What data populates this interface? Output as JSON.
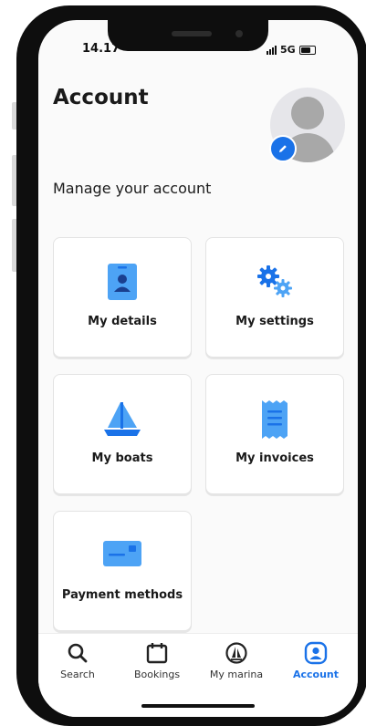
{
  "status_bar": {
    "time": "14.17",
    "network": "5G"
  },
  "header": {
    "title": "Account",
    "subtitle": "Manage your account"
  },
  "avatar": {
    "icon": "user-avatar-placeholder",
    "edit_icon": "pencil-icon"
  },
  "cards": [
    {
      "label": "My details",
      "icon": "id-card-icon"
    },
    {
      "label": "My settings",
      "icon": "gears-icon"
    },
    {
      "label": "My boats",
      "icon": "sailboat-icon"
    },
    {
      "label": "My invoices",
      "icon": "invoice-icon"
    },
    {
      "label": "Payment methods",
      "icon": "credit-card-icon"
    }
  ],
  "nav": [
    {
      "label": "Search",
      "icon": "search-icon",
      "active": false
    },
    {
      "label": "Bookings",
      "icon": "calendar-icon",
      "active": false
    },
    {
      "label": "My marina",
      "icon": "marina-icon",
      "active": false
    },
    {
      "label": "Account",
      "icon": "account-icon",
      "active": true
    }
  ],
  "colors": {
    "accent": "#1a72e8",
    "icon_light": "#4da3f5"
  }
}
